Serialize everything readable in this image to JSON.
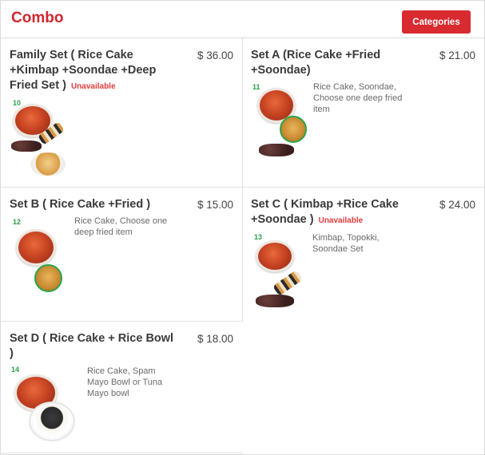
{
  "header": {
    "title": "Combo",
    "categories_label": "Categories"
  },
  "items": [
    {
      "name": "Family Set ( Rice Cake +Kimbap +Soondae +Deep Fried Set )",
      "unavailable": "Unavailable",
      "price": "$ 36.00",
      "number": "10",
      "description": ""
    },
    {
      "name": "Set A (Rice Cake +Fried +Soondae)",
      "unavailable": "",
      "price": "$ 21.00",
      "number": "11",
      "description": "Rice Cake, Soondae, Choose one deep fried item"
    },
    {
      "name": "Set B ( Rice Cake +Fried )",
      "unavailable": "",
      "price": "$ 15.00",
      "number": "12",
      "description": "Rice Cake, Choose one deep fried item"
    },
    {
      "name": "Set C ( Kimbap +Rice Cake +Soondae )",
      "unavailable": "Unavailable",
      "price": "$ 24.00",
      "number": "13",
      "description": "Kimbap, Topokki, Soondae Set"
    },
    {
      "name": "Set D ( Rice Cake + Rice Bowl )",
      "unavailable": "",
      "price": "$ 18.00",
      "number": "14",
      "description": "Rice Cake, Spam Mayo Bowl or Tuna Mayo bowl"
    }
  ]
}
